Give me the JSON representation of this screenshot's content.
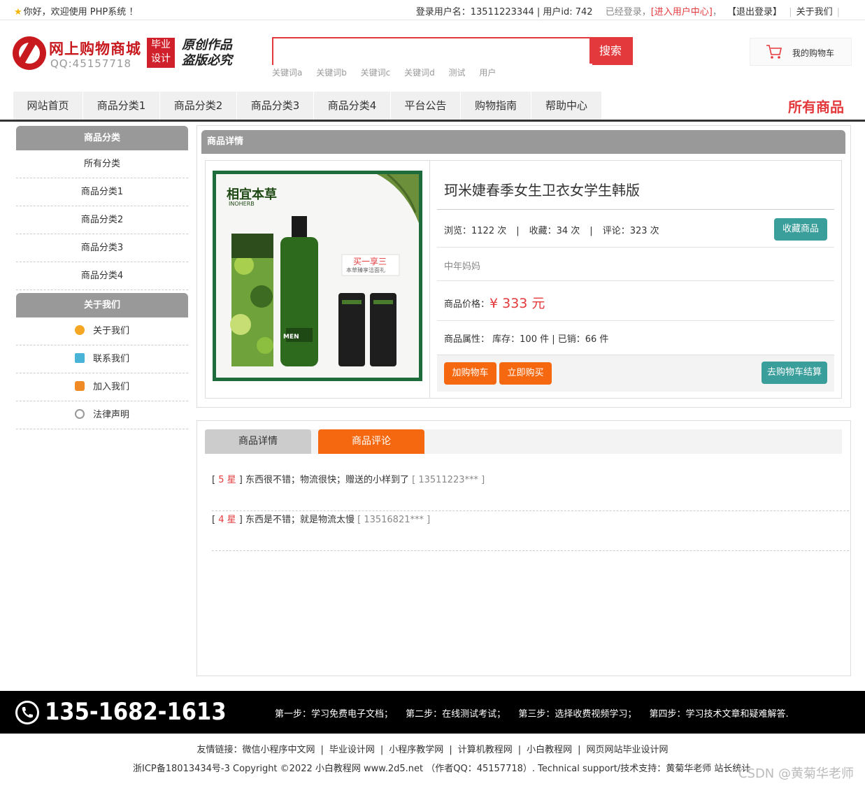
{
  "topbar": {
    "welcome": "你好，欢迎使用 PHP系统 ！",
    "login_info": "登录用户名：13511223344 | 用户id: 742",
    "logged_in": "已经登录，",
    "user_center": "[进入用户中心]",
    "logout": "【退出登录】",
    "about": "关于我们"
  },
  "header": {
    "site_title": "网上购物商城",
    "qq": "QQ:45157718",
    "grad_line1": "毕业",
    "grad_line2": "设计",
    "slogan_line1": "原创作品",
    "slogan_line2": "盗版必究",
    "search_placeholder": "",
    "search_button": "搜索",
    "keywords": [
      "关键词a",
      "关键词b",
      "关键词c",
      "关键词d",
      "测试",
      "用户"
    ],
    "cart_label": "我的购物车"
  },
  "nav": {
    "items": [
      "网站首页",
      "商品分类1",
      "商品分类2",
      "商品分类3",
      "商品分类4",
      "平台公告",
      "购物指南",
      "帮助中心"
    ],
    "all_products": "所有商品"
  },
  "sidebar": {
    "category_title": "商品分类",
    "categories": [
      "所有分类",
      "商品分类1",
      "商品分类2",
      "商品分类3",
      "商品分类4"
    ],
    "about_title": "关于我们",
    "about_items": [
      "关于我们",
      "联系我们",
      "加入我们",
      "法律声明"
    ]
  },
  "detail": {
    "panel_title": "商品详情",
    "product_name": "珂米婕春季女生卫衣女学生韩版",
    "views": "浏览：1122 次",
    "favorites": "收藏：34 次",
    "reviews": "评论：323 次",
    "favorite_button": "收藏商品",
    "category_tag": "中年妈妈",
    "price_label": "商品价格：",
    "price": "¥ 333 元",
    "attr_label": "商品属性：",
    "attr_value": "库存：100 件 | 已销：66 件",
    "add_cart": "加购物车",
    "buy_now": "立即购买",
    "checkout": "去购物车结算",
    "image": {
      "brand": "相宜本草",
      "brand_en": "INOHERB",
      "promo": "买一享三",
      "promo_sub": "本草臻享洁面礼",
      "men": "MEN"
    }
  },
  "comments": {
    "tab_detail": "商品详情",
    "tab_comments": "商品评论",
    "list": [
      {
        "stars": "5 星",
        "text": "东西很不错；物流很快；赠送的小样到了",
        "user": "[ 13511223*** ]"
      },
      {
        "stars": "4 星",
        "text": "东西是不错；就是物流太慢",
        "user": "[ 13516821*** ]"
      }
    ]
  },
  "footer": {
    "phone": "135-1682-1613",
    "steps": [
      "第一步：学习免费电子文档；",
      "第二步：在线测试考试；",
      "第三步：选择收费视频学习；",
      "第四步：学习技术文章和疑难解答."
    ],
    "links_label": "友情链接：",
    "links": [
      "微信小程序中文网",
      "毕业设计网",
      "小程序教学网",
      "计算机教程网",
      "小白教程网",
      "网页网站毕业设计网"
    ],
    "copyright": "浙ICP备18013434号-3 Copyright ©2022 小白教程网 www.2d5.net （作者QQ：45157718）. Technical support/技术支持：黄菊华老师 站长统计",
    "watermark": "CSDN @黄菊华老师"
  },
  "colors": {
    "brand_red": "#e4393c",
    "orange": "#f5680f",
    "teal": "#3a9e9b",
    "header_gray": "#999999"
  }
}
